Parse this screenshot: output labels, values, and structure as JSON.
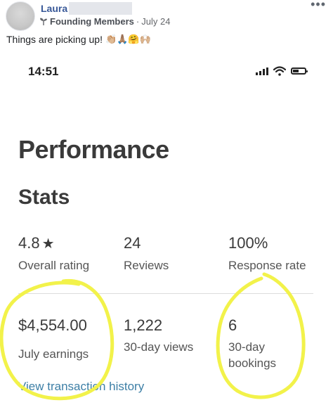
{
  "post": {
    "author": "Laura",
    "group": "Founding Members",
    "separator": "·",
    "date": "July 24",
    "text": "Things are picking up!",
    "emojis": "👏🏼🙏🏽🤗🙌🏼",
    "more": "•••"
  },
  "phone": {
    "time": "14:51",
    "title": "Performance",
    "section": "Stats",
    "stats_row1": [
      {
        "value": "4.8",
        "label": "Overall rating"
      },
      {
        "value": "24",
        "label": "Reviews"
      },
      {
        "value": "100%",
        "label": "Response rate"
      }
    ],
    "stats_row2": [
      {
        "value": "$4,554.00",
        "label": "July earnings"
      },
      {
        "value": "1,222",
        "label": "30-day views"
      },
      {
        "value": "6",
        "label_line1": "30-day",
        "label_line2": "bookings"
      }
    ],
    "link": "View transaction history"
  },
  "colors": {
    "link": "#3d7fa6",
    "author": "#385898",
    "highlight_circle": "#f2f24a"
  },
  "icons": [
    "sprout-icon",
    "more-icon",
    "signal-icon",
    "wifi-icon",
    "battery-icon",
    "star-icon"
  ]
}
